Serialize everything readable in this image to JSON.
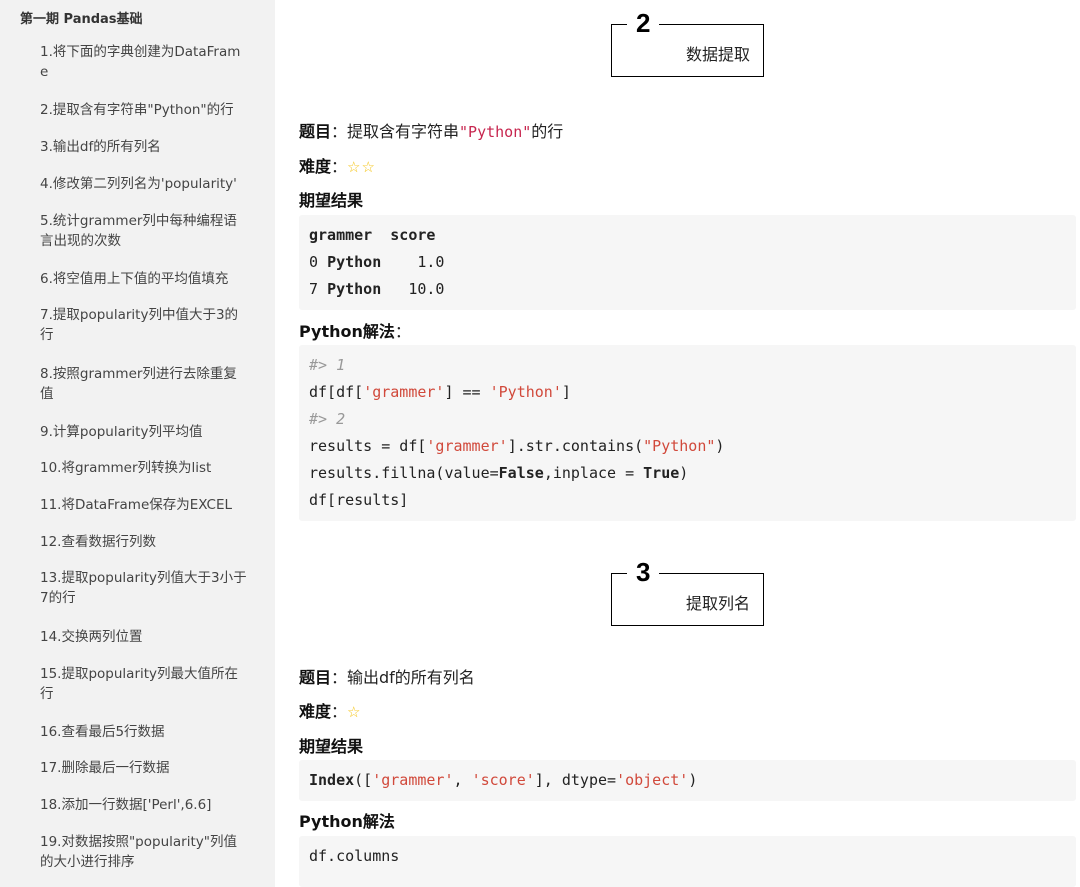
{
  "sidebar": {
    "title": "第一期 Pandas基础",
    "items": [
      {
        "label": "1.将下面的字典创建为DataFram\ne"
      },
      {
        "label": "2.提取含有字符串\"Python\"的行"
      },
      {
        "label": "3.输出df的所有列名"
      },
      {
        "label": "4.修改第二列列名为'popularity'"
      },
      {
        "label": "5.统计grammer列中每种编程语\n言出现的次数"
      },
      {
        "label": "6.将空值用上下值的平均值填充"
      },
      {
        "label": "7.提取popularity列中值大于3的\n行"
      },
      {
        "label": "8.按照grammer列进行去除重复\n值"
      },
      {
        "label": "9.计算popularity列平均值"
      },
      {
        "label": "10.将grammer列转换为list"
      },
      {
        "label": "11.将DataFrame保存为EXCEL"
      },
      {
        "label": "12.查看数据行列数"
      },
      {
        "label": "13.提取popularity列值大于3小于\n7的行"
      },
      {
        "label": "14.交换两列位置"
      },
      {
        "label": "15.提取popularity列最大值所在\n行"
      },
      {
        "label": "16.查看最后5行数据"
      },
      {
        "label": "17.删除最后一行数据"
      },
      {
        "label": "18.添加一行数据['Perl',6.6]"
      },
      {
        "label": "19.对数据按照\"popularity\"列值\n的大小进行排序"
      }
    ]
  },
  "sections": [
    {
      "number": "2",
      "title": "数据提取",
      "question_label": "题目",
      "question_text": "：提取含有字符串",
      "question_code": "\"Python\"",
      "question_tail": "的行",
      "difficulty_label": "难度",
      "difficulty_colon": "：",
      "difficulty_stars": "☆☆",
      "expected_label": "期望结果",
      "expected_header": "grammer  score",
      "expected_rows": [
        {
          "idx": "0",
          "lang": "Python",
          "val": "    1.0"
        },
        {
          "idx": "7",
          "lang": "Python",
          "val": "   10.0"
        }
      ],
      "solution_label": "Python解法",
      "solution_colon": "：",
      "code": {
        "c1": "#> 1",
        "l2a": "df[df[",
        "l2s": "'grammer'",
        "l2b": "] == ",
        "l2s2": "'Python'",
        "l2c": "]",
        "c3": "#> 2",
        "l4a": "results = df[",
        "l4s": "'grammer'",
        "l4b": "].str.contains(",
        "l4s2": "\"Python\"",
        "l4c": ")",
        "l5a": "results.fillna(value=",
        "l5k": "False",
        "l5b": ",inplace = ",
        "l5k2": "True",
        "l5c": ")",
        "l6": "df[results]"
      }
    },
    {
      "number": "3",
      "title": "提取列名",
      "question_label": "题目",
      "question_text": "：输出df的所有列名",
      "difficulty_label": "难度",
      "difficulty_colon": "：",
      "difficulty_stars": "☆",
      "expected_label": "期望结果",
      "expected": {
        "a": "Index",
        "b": "([",
        "s1": "'grammer'",
        "c": ", ",
        "s2": "'score'",
        "d": "], dtype=",
        "s3": "'object'",
        "e": ")"
      },
      "solution_label": "Python解法",
      "code": "df.columns"
    }
  ]
}
